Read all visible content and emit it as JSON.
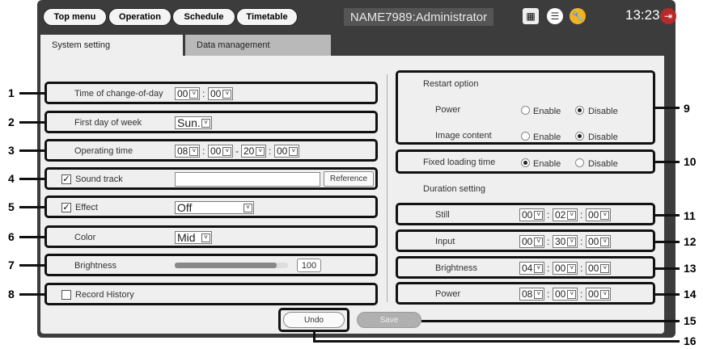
{
  "topbar": {
    "buttons": [
      "Top menu",
      "Operation",
      "Schedule",
      "Timetable"
    ],
    "user": "NAME7989:Administrator",
    "clock": "13:23"
  },
  "tabs": [
    "System setting",
    "Data management"
  ],
  "left": {
    "change_of_day": {
      "label": "Time of change-of-day",
      "hh": "00",
      "mm": "00"
    },
    "first_day": {
      "label": "First day of week",
      "value": "Sun."
    },
    "operating": {
      "label": "Operating time",
      "h1": "08",
      "m1": "00",
      "h2": "20",
      "m2": "00"
    },
    "sound": {
      "label": "Sound track",
      "button": "Reference"
    },
    "effect": {
      "label": "Effect",
      "value": "Off"
    },
    "color": {
      "label": "Color",
      "value": "Mid"
    },
    "brightness": {
      "label": "Brightness",
      "value": "100",
      "level": 0.9
    },
    "history": {
      "label": "Record History"
    }
  },
  "right": {
    "restart": {
      "title": "Restart option",
      "power": "Power",
      "image": "Image content",
      "enable": "Enable",
      "disable": "Disable"
    },
    "fixed": {
      "label": "Fixed loading time",
      "enable": "Enable",
      "disable": "Disable"
    },
    "duration": {
      "title": "Duration setting"
    },
    "still": {
      "label": "Still",
      "h": "00",
      "m": "02",
      "s": "00"
    },
    "input": {
      "label": "Input",
      "h": "00",
      "m": "30",
      "s": "00"
    },
    "brightness": {
      "label": "Brightness",
      "h": "04",
      "m": "00",
      "s": "00"
    },
    "power": {
      "label": "Power",
      "h": "08",
      "m": "00",
      "s": "00"
    }
  },
  "actions": {
    "undo": "Undo",
    "save": "Save"
  },
  "callouts": [
    "1",
    "2",
    "3",
    "4",
    "5",
    "6",
    "7",
    "8",
    "9",
    "10",
    "11",
    "12",
    "13",
    "14",
    "15",
    "16"
  ]
}
